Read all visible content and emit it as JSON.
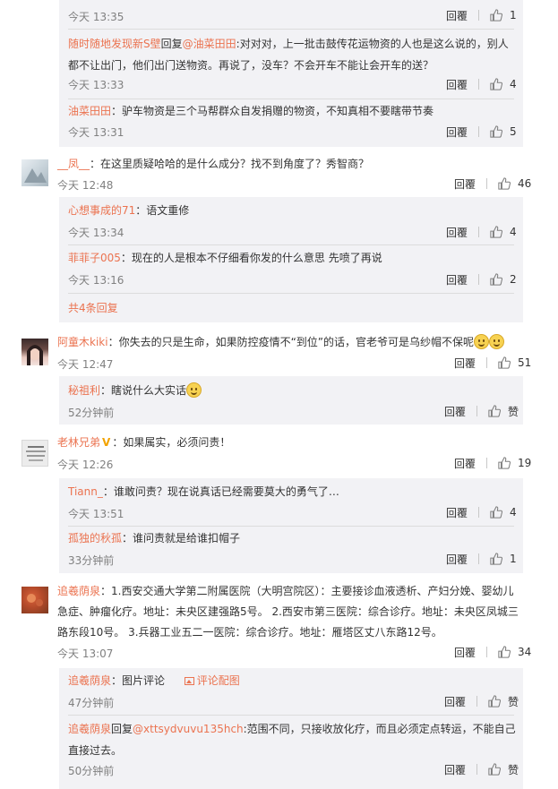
{
  "labels": {
    "reply": "回覆",
    "reply_to_prefix": "回复",
    "more_replies": "共4条回复",
    "pic_comment": "图片评论",
    "comment_pic": "评论配图"
  },
  "replies_top": [
    {
      "user": "",
      "text": "",
      "time": "今天 13:35",
      "likes": "1"
    },
    {
      "user": "随时随地发现新S壁",
      "reply_to": "@油菜田田",
      "text": ":对对对，上一批击鼓传花运物资的人也是这么说的，别人都不让出门，他们出门送物资。再说了，没车？不会开车不能让会开车的送？",
      "time": "今天 13:33",
      "likes": "4"
    },
    {
      "user": "油菜田田",
      "text": "：驴车物资是三个马帮群众自发捐赠的物资，不知真相不要瞎带节奏",
      "time": "今天 13:31",
      "likes": "5"
    }
  ],
  "comments": [
    {
      "user": "__凤__",
      "text": "：在这里质疑哈哈的是什么成分？找不到角度了？秀智商？",
      "time": "今天 12:48",
      "likes": "46",
      "replies": [
        {
          "user": "心想事成的71",
          "text": "：语文重修",
          "time": "今天 13:34",
          "likes": "4"
        },
        {
          "user": "菲菲子005",
          "text": "：现在的人是根本不仔细看你发的什么意思 先喷了再说",
          "time": "今天 13:16",
          "likes": "2"
        }
      ]
    },
    {
      "user": "阿童木kiki",
      "text": "：你失去的只是生命，如果防控疫情不“到位”的话，官老爷可是乌纱帽不保呢",
      "time": "今天 12:47",
      "likes": "51",
      "replies": [
        {
          "user": "秘祖利",
          "text": "：瞎说什么大实话",
          "time": "52分钟前",
          "likes": "赞"
        }
      ]
    },
    {
      "user": "老林兄弟",
      "text": "：如果属实，必须问责！",
      "time": "今天 12:26",
      "likes": "19",
      "replies": [
        {
          "user": "Tiann_",
          "text": "：谁敢问责？现在说真话已经需要莫大的勇气了…",
          "time": "今天 13:51",
          "likes": "4"
        },
        {
          "user": "孤独的秋孤",
          "text": "：谁问责就是给谁扣帽子",
          "time": "33分钟前",
          "likes": "1"
        }
      ]
    },
    {
      "user": "追羲荫泉",
      "text": "：1.西安交通大学第二附属医院（大明宫院区）：主要接诊血液透析、产妇分娩、婴幼儿急症、肿瘤化疗。地址：未央区建强路5号。 2.西安市第三医院：综合诊疗。地址：未央区凤城三路东段10号。 3.兵器工业五二一医院：综合诊疗。地址：雁塔区丈八东路12号。",
      "time": "今天 13:07",
      "likes": "34",
      "replies": [
        {
          "user": "追羲荫泉",
          "text": "：",
          "time": "47分钟前",
          "likes": "赞"
        },
        {
          "user": "追羲荫泉",
          "reply_to": "@xttsydvuvu135hch",
          "text": ":范围不同，只接收放化疗，而且必须定点转运，不能自己直接过去。",
          "time": "50分钟前",
          "likes": "赞"
        }
      ]
    }
  ]
}
